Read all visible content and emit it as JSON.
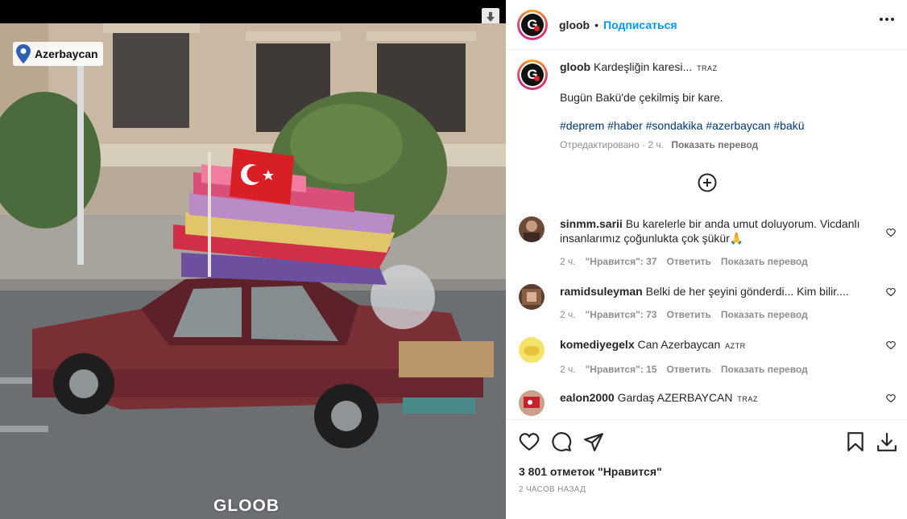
{
  "media": {
    "location": "Azerbaycan",
    "watermark": "GLOOB",
    "download_icon": "download-arrow-icon",
    "location_icon": "map-pin-icon"
  },
  "header": {
    "username": "gloob",
    "separator": "•",
    "follow_label": "Подписаться",
    "more_icon": "more-horizontal-icon"
  },
  "caption": {
    "username": "gloob",
    "text": "Kardeşliğin karesi...",
    "translit_badge": "TRAZ",
    "line2": "Bugün Bakü'de çekilmiş bir kare.",
    "hashtags": "#deprem #haber #sondakika #azerbaycan #bakü",
    "edited": "Отредактировано · 2 ч.",
    "translate": "Показать перевод"
  },
  "load_more_icon": "plus-circle-icon",
  "comments": [
    {
      "username": "sinmm.sarii",
      "text": "Bu karelerle bir anda umut doluyorum. Vicdanlı insanlarımız çoğunlukta çok şükür🙏",
      "time": "2 ч.",
      "likes": "\"Нравится\": 37",
      "reply": "Ответить",
      "translate": "Показать перевод"
    },
    {
      "username": "ramidsuleyman",
      "text": "Belki de her şeyini gönderdi... Kim bilir....",
      "time": "2 ч.",
      "likes": "\"Нравится\": 73",
      "reply": "Ответить",
      "translate": "Показать перевод"
    },
    {
      "username": "komediyegelx",
      "text": "Can Azerbaycan",
      "badge": "AZTR",
      "time": "2 ч.",
      "likes": "\"Нравится\": 15",
      "reply": "Ответить",
      "translate": "Показать перевод"
    },
    {
      "username": "ealon2000",
      "text": "Gardaş AZERBAYCAN",
      "badge": "TRAZ"
    }
  ],
  "footer": {
    "likes": "3 801 отметок \"Нравится\"",
    "time": "2 часов назад",
    "icons": [
      "heart-icon",
      "comment-icon",
      "share-icon",
      "bookmark-icon",
      "download-icon"
    ]
  },
  "colors": {
    "link_blue": "#0095f6",
    "hashtag": "#00376b",
    "muted": "#8e8e8e",
    "text": "#262626"
  }
}
